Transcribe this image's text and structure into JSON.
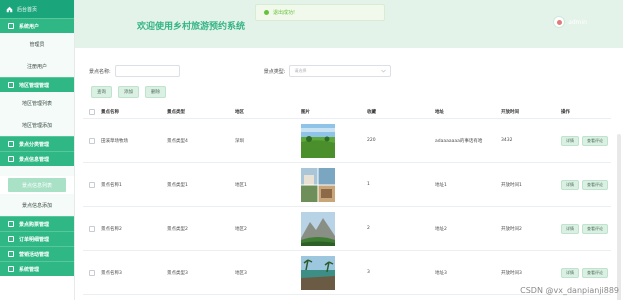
{
  "sidebar": {
    "brand": "后台首页",
    "groups": [
      {
        "label": "系统用户",
        "items": [
          "管理员",
          "注册用户"
        ]
      },
      {
        "label": "地区管理管理",
        "items": [
          "地区管理列表",
          "地区管理添加"
        ]
      },
      {
        "label": "景点分类管理"
      },
      {
        "label": "景点信息管理",
        "items": [
          "景点信息列表",
          "景点信息添加"
        ]
      },
      {
        "label": "景点购票管理"
      },
      {
        "label": "订单明细管理"
      },
      {
        "label": "营销活动管理"
      },
      {
        "label": "系统管理"
      }
    ]
  },
  "header": {
    "title": "欢迎使用乡村旅游预约系统",
    "toast": "退出成功!",
    "user": "admin"
  },
  "search": {
    "name_label": "景点名称:",
    "type_label": "景点类型:",
    "type_placeholder": "请选择"
  },
  "buttons": {
    "query": "查询",
    "add": "添加",
    "delete": "删除"
  },
  "table": {
    "headers": [
      "景点名称",
      "景点类型",
      "地区",
      "图片",
      "收藏",
      "地址",
      "开放时间",
      "操作"
    ],
    "rows": [
      {
        "name": "田溪草场牧场",
        "type": "景点类型4",
        "area": "深圳",
        "fav": "220",
        "addr": "adaaaaaaa的事话有哈",
        "time": "3432",
        "img": "grassland"
      },
      {
        "name": "景点名称1",
        "type": "景点类型1",
        "area": "地区1",
        "fav": "1",
        "addr": "地址1",
        "time": "开放时间1",
        "img": "town"
      },
      {
        "name": "景点名称2",
        "type": "景点类型2",
        "area": "地区2",
        "fav": "2",
        "addr": "地址2",
        "time": "开放时间2",
        "img": "mountain"
      },
      {
        "name": "景点名称3",
        "type": "景点类型3",
        "area": "地区3",
        "fav": "3",
        "addr": "地址3",
        "time": "开放时间3",
        "img": "resort"
      }
    ],
    "op_detail": "详情",
    "op_review": "查看评论"
  },
  "watermark": "CSDN @vx_danpianji889",
  "colors": {
    "accent": "#2fb785",
    "brand": "#1aa57a",
    "header_bg": "#e3f3e9"
  }
}
